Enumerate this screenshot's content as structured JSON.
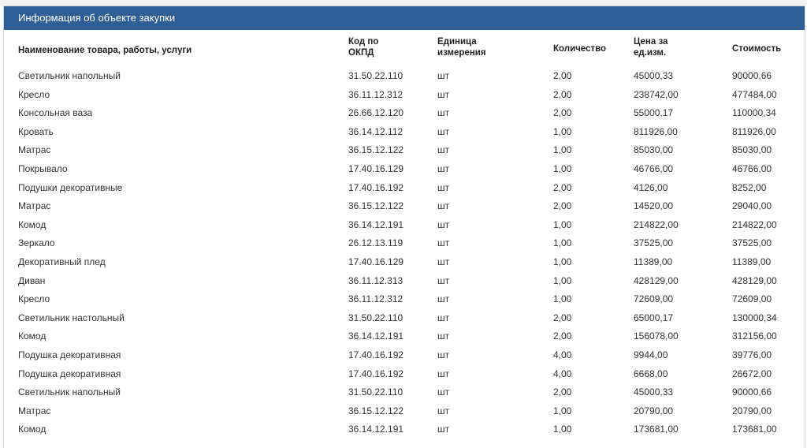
{
  "panel": {
    "title": "Информация об объекте закупки"
  },
  "table": {
    "headers": {
      "name": "Наименование товара, работы, услуги",
      "okpd": "Код по ОКПД",
      "unit": "Единица измерения",
      "qty": "Количество",
      "price": "Цена за ед.изм.",
      "cost": "Стоимость"
    },
    "rows": [
      [
        "Светильник напольный",
        "31.50.22.110",
        "шт",
        "2,00",
        "45000,33",
        "90000,66"
      ],
      [
        "Кресло",
        "36.11.12.312",
        "шт",
        "2,00",
        "238742,00",
        "477484,00"
      ],
      [
        "Консольная ваза",
        "26.66.12.120",
        "шт",
        "2,00",
        "55000,17",
        "110000,34"
      ],
      [
        "Кровать",
        "36.14.12.112",
        "шт",
        "1,00",
        "811926,00",
        "811926,00"
      ],
      [
        "Матрас",
        "36.15.12.122",
        "шт",
        "1,00",
        "85030,00",
        "85030,00"
      ],
      [
        "Покрывало",
        "17.40.16.129",
        "шт",
        "1,00",
        "46766,00",
        "46766,00"
      ],
      [
        "Подушки декоративные",
        "17.40.16.192",
        "шт",
        "2,00",
        "4126,00",
        "8252,00"
      ],
      [
        "Матрас",
        "36.15.12.122",
        "шт",
        "2,00",
        "14520,00",
        "29040,00"
      ],
      [
        "Комод",
        "36.14.12.191",
        "шт",
        "1,00",
        "214822,00",
        "214822,00"
      ],
      [
        "Зеркало",
        "26.12.13.119",
        "шт",
        "1,00",
        "37525,00",
        "37525,00"
      ],
      [
        "Декоративный плед",
        "17.40.16.129",
        "шт",
        "1,00",
        "11389,00",
        "11389,00"
      ],
      [
        "Диван",
        "36.11.12.313",
        "шт",
        "1,00",
        "428129,00",
        "428129,00"
      ],
      [
        "Кресло",
        "36.11.12.312",
        "шт",
        "1,00",
        "72609,00",
        "72609,00"
      ],
      [
        "Светильник настольный",
        "31.50.22.110",
        "шт",
        "2,00",
        "65000,17",
        "130000,34"
      ],
      [
        "Комод",
        "36.14.12.191",
        "шт",
        "2,00",
        "156078,00",
        "312156,00"
      ],
      [
        "Подушка декоративная",
        "17.40.16.192",
        "шт",
        "4,00",
        "9944,00",
        "39776,00"
      ],
      [
        "Подушка декоративная",
        "17.40.16.192",
        "шт",
        "4,00",
        "6668,00",
        "26672,00"
      ],
      [
        "Светильник напольный",
        "31.50.22.110",
        "шт",
        "2,00",
        "45000,33",
        "90000,66"
      ],
      [
        "Матрас",
        "36.15.12.122",
        "шт",
        "1,00",
        "20790,00",
        "20790,00"
      ],
      [
        "Комод",
        "36.14.12.191",
        "шт",
        "1,00",
        "173681,00",
        "173681,00"
      ]
    ]
  }
}
